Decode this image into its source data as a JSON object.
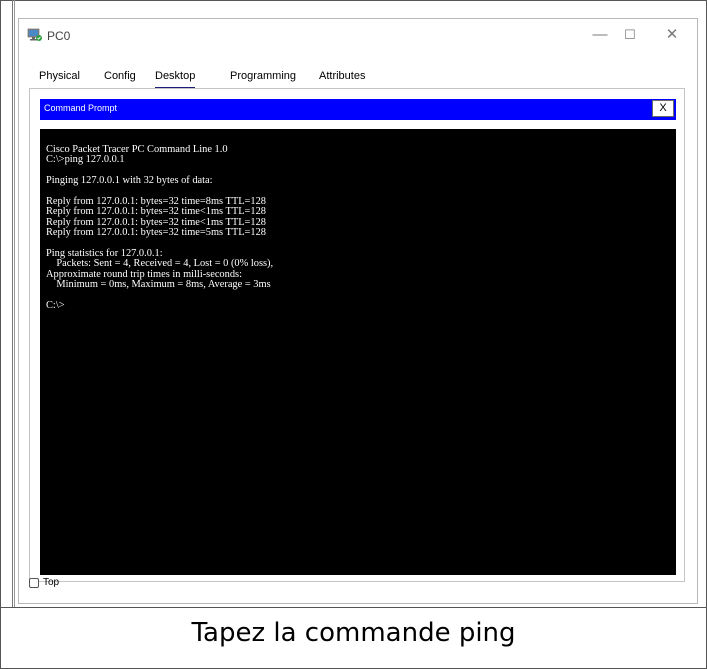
{
  "window": {
    "title": "PC0",
    "controls": {
      "minimize": "—",
      "maximize": "☐",
      "close": "✕"
    }
  },
  "tabs": [
    {
      "label": "Physical"
    },
    {
      "label": "Config"
    },
    {
      "label": "Desktop",
      "active": true
    },
    {
      "label": "Programming"
    },
    {
      "label": "Attributes"
    }
  ],
  "command_prompt": {
    "title": "Command Prompt",
    "close_label": "X",
    "output": "Cisco Packet Tracer PC Command Line 1.0\nC:\\>ping 127.0.0.1\n\nPinging 127.0.0.1 with 32 bytes of data:\n\nReply from 127.0.0.1: bytes=32 time=8ms TTL=128\nReply from 127.0.0.1: bytes=32 time<1ms TTL=128\nReply from 127.0.0.1: bytes=32 time<1ms TTL=128\nReply from 127.0.0.1: bytes=32 time=5ms TTL=128\n\nPing statistics for 127.0.0.1:\n    Packets: Sent = 4, Received = 4, Lost = 0 (0% loss),\nApproximate round trip times in milli-seconds:\n    Minimum = 0ms, Maximum = 8ms, Average = 3ms\n\nC:\\>"
  },
  "top_checkbox": {
    "label": "Top",
    "checked": false
  },
  "caption": "Tapez la commande ping",
  "colors": {
    "cmd_titlebar": "#0000ff",
    "terminal_bg": "#000000",
    "terminal_fg": "#ffffff",
    "active_tab_underline": "#1d1d7a"
  }
}
